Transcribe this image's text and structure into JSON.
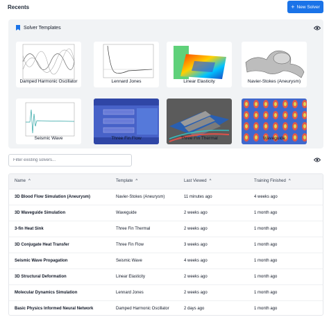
{
  "header": {
    "title": "Recents",
    "new_button": "New Solver"
  },
  "templates": {
    "title": "Solver Templates",
    "items": [
      {
        "label": "Damped Harmonic Oscillator"
      },
      {
        "label": "Lennard Jones"
      },
      {
        "label": "Linear Elasticity"
      },
      {
        "label": "Navier-Stokes (Aneurysm)"
      },
      {
        "label": "Seismic Wave"
      },
      {
        "label": "Three Fin Flow"
      },
      {
        "label": "Three Fin Thermal"
      },
      {
        "label": "Waveguide"
      }
    ]
  },
  "filter": {
    "placeholder": "Filter existing solvers...",
    "value": ""
  },
  "table": {
    "columns": [
      "Name",
      "Template",
      "Last Viewed",
      "Training Finished"
    ],
    "sort_icons": [
      "^",
      "^",
      "^",
      "^"
    ],
    "rows": [
      {
        "name": "3D Blood Flow Simulation (Aneurysm)",
        "template": "Navier-Stokes (Aneurysm)",
        "last_viewed": "11 minutes ago",
        "training": "4 weeks ago"
      },
      {
        "name": "3D Waveguide Simulation",
        "template": "Waveguide",
        "last_viewed": "2 weeks ago",
        "training": "1 month ago"
      },
      {
        "name": "3-fin Heat Sink",
        "template": "Three Fin Thermal",
        "last_viewed": "2 weeks ago",
        "training": "1 month ago"
      },
      {
        "name": "3D Conjugate Heat Transfer",
        "template": "Three Fin Flow",
        "last_viewed": "3 weeks ago",
        "training": "1 month ago"
      },
      {
        "name": "Seismic Wave Propagation",
        "template": "Seismic Wave",
        "last_viewed": "4 weeks ago",
        "training": "1 month ago"
      },
      {
        "name": "3D Structural Deformation",
        "template": "Linear Elasticity",
        "last_viewed": "2 weeks ago",
        "training": "1 month ago"
      },
      {
        "name": "Molecular Dynamics Simulation",
        "template": "Lennard Jones",
        "last_viewed": "2 weeks ago",
        "training": "1 month ago"
      },
      {
        "name": "Basic Physics Informed Neural Network",
        "template": "Damped Harmonic Oscillator",
        "last_viewed": "2 days ago",
        "training": "1 month ago"
      }
    ]
  },
  "colors": {
    "primary": "#1a73e8",
    "panel": "#f1f3f5"
  }
}
